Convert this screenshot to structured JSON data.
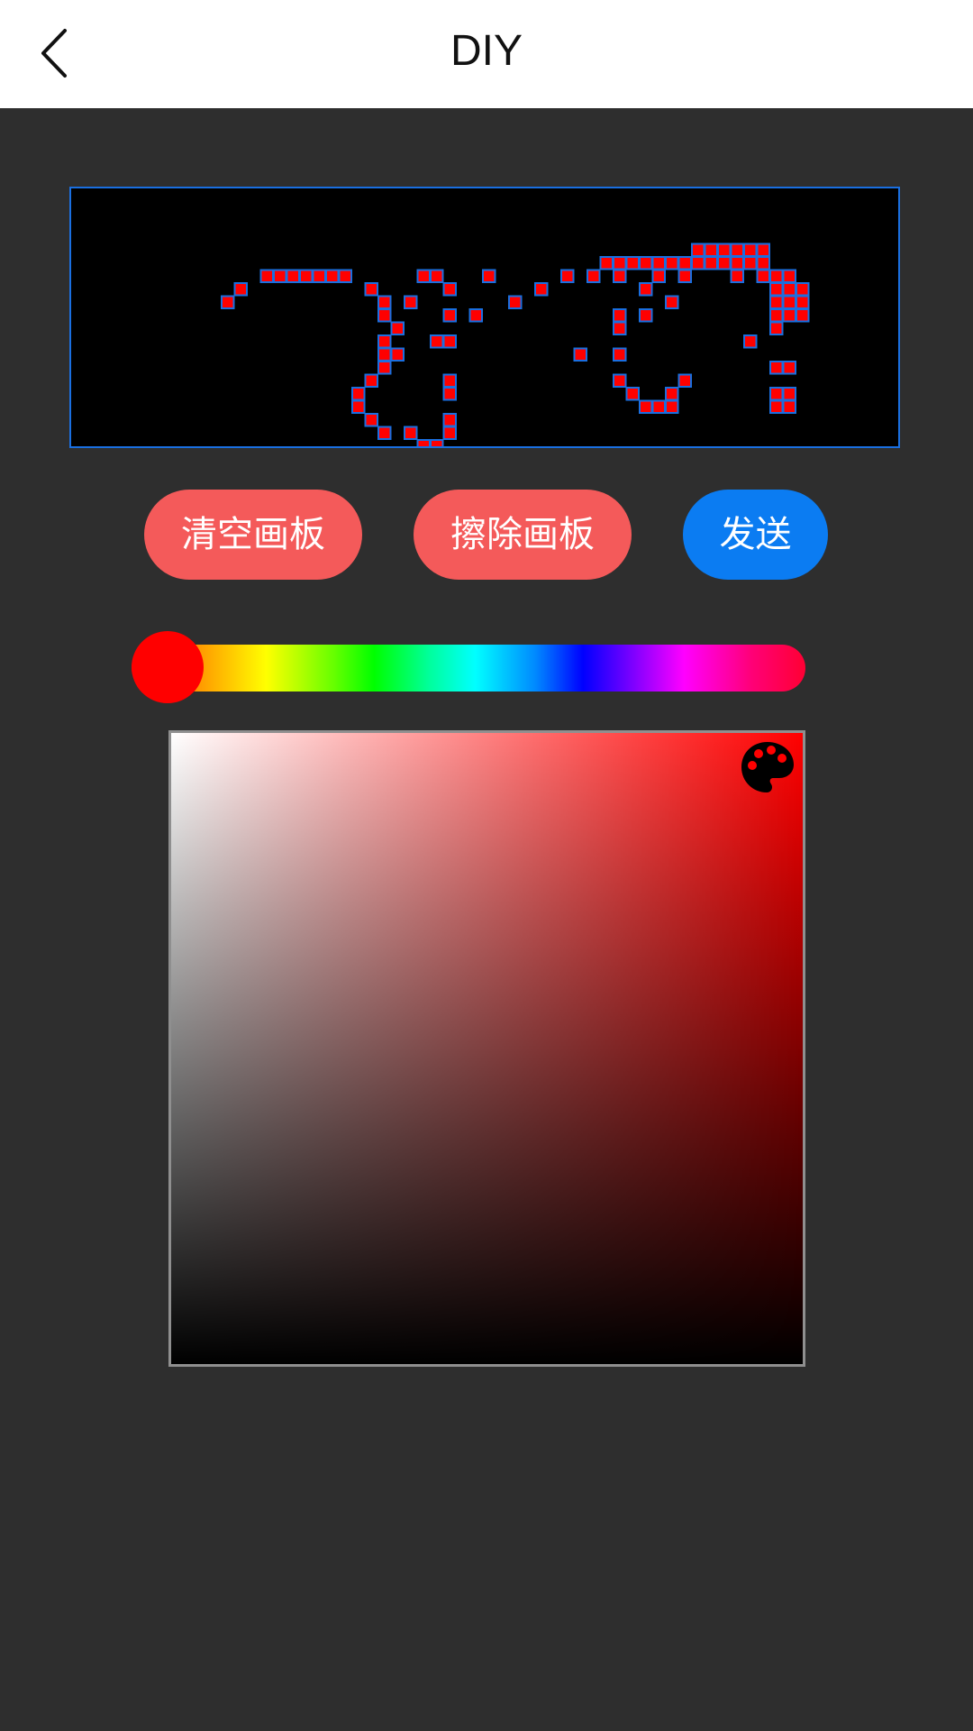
{
  "header": {
    "title": "DIY",
    "back_icon": "chevron-left-icon"
  },
  "drawing_canvas": {
    "cell_color": "#ff0000",
    "cell_border_color": "#1a6fe0",
    "background_color": "#000000",
    "lit_cells": [
      [
        4,
        7
      ],
      [
        5,
        6
      ],
      [
        7,
        5
      ],
      [
        8,
        5
      ],
      [
        9,
        5
      ],
      [
        10,
        5
      ],
      [
        11,
        5
      ],
      [
        12,
        5
      ],
      [
        13,
        5
      ],
      [
        15,
        6
      ],
      [
        16,
        7
      ],
      [
        16,
        8
      ],
      [
        17,
        9
      ],
      [
        16,
        10
      ],
      [
        16,
        11
      ],
      [
        17,
        11
      ],
      [
        16,
        12
      ],
      [
        15,
        13
      ],
      [
        14,
        14
      ],
      [
        14,
        15
      ],
      [
        15,
        16
      ],
      [
        16,
        17
      ],
      [
        18,
        17
      ],
      [
        19,
        18
      ],
      [
        20,
        18
      ],
      [
        21,
        17
      ],
      [
        21,
        16
      ],
      [
        19,
        5
      ],
      [
        20,
        5
      ],
      [
        21,
        6
      ],
      [
        18,
        7
      ],
      [
        21,
        8
      ],
      [
        20,
        10
      ],
      [
        21,
        10
      ],
      [
        21,
        13
      ],
      [
        21,
        14
      ],
      [
        23,
        8
      ],
      [
        24,
        5
      ],
      [
        26,
        7
      ],
      [
        28,
        6
      ],
      [
        30,
        5
      ],
      [
        32,
        5
      ],
      [
        33,
        4
      ],
      [
        34,
        4
      ],
      [
        35,
        4
      ],
      [
        36,
        4
      ],
      [
        37,
        4
      ],
      [
        38,
        4
      ],
      [
        39,
        4
      ],
      [
        40,
        4
      ],
      [
        41,
        4
      ],
      [
        42,
        4
      ],
      [
        43,
        4
      ],
      [
        44,
        4
      ],
      [
        45,
        4
      ],
      [
        40,
        3
      ],
      [
        41,
        3
      ],
      [
        42,
        3
      ],
      [
        43,
        3
      ],
      [
        44,
        3
      ],
      [
        45,
        3
      ],
      [
        34,
        5
      ],
      [
        37,
        5
      ],
      [
        39,
        5
      ],
      [
        43,
        5
      ],
      [
        45,
        5
      ],
      [
        46,
        5
      ],
      [
        47,
        5
      ],
      [
        36,
        6
      ],
      [
        46,
        6
      ],
      [
        47,
        6
      ],
      [
        48,
        6
      ],
      [
        38,
        7
      ],
      [
        46,
        7
      ],
      [
        47,
        7
      ],
      [
        48,
        7
      ],
      [
        34,
        8
      ],
      [
        36,
        8
      ],
      [
        46,
        8
      ],
      [
        47,
        8
      ],
      [
        48,
        8
      ],
      [
        34,
        9
      ],
      [
        46,
        9
      ],
      [
        44,
        10
      ],
      [
        31,
        11
      ],
      [
        34,
        11
      ],
      [
        46,
        12
      ],
      [
        47,
        12
      ],
      [
        34,
        13
      ],
      [
        35,
        14
      ],
      [
        36,
        15
      ],
      [
        37,
        15
      ],
      [
        38,
        15
      ],
      [
        38,
        14
      ],
      [
        39,
        13
      ],
      [
        46,
        14
      ],
      [
        47,
        14
      ],
      [
        46,
        15
      ],
      [
        47,
        15
      ]
    ]
  },
  "buttons": {
    "clear": "清空画板",
    "erase": "擦除画板",
    "send": "发送"
  },
  "hue_slider": {
    "value": 0
  },
  "color_picker": {
    "hue_color": "#ff0000",
    "icon": "palette-icon"
  }
}
